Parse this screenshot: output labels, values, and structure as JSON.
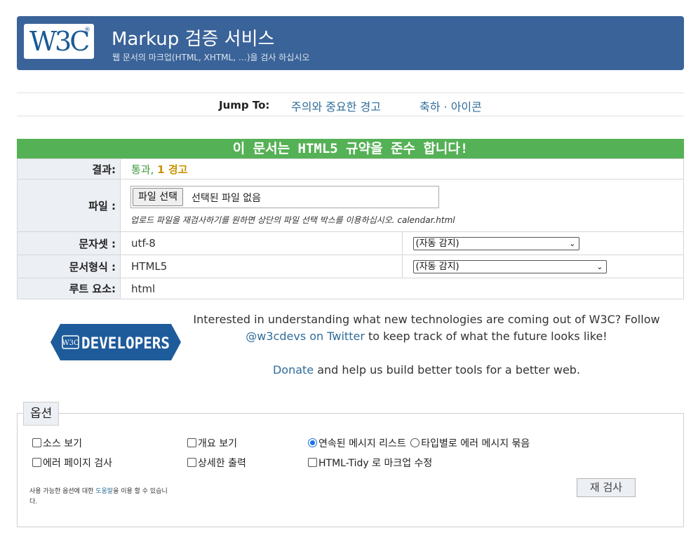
{
  "header": {
    "logo_text": "W3C",
    "logo_reg": "®",
    "title": "Markup 검증 서비스",
    "subtitle": "웹 문서의 마크업(HTML, XHTML, …)을 검사 하십시오"
  },
  "jump": {
    "label": "Jump To:",
    "links": [
      "주의와 중요한 경고",
      "축하 · 아이콘"
    ]
  },
  "result": {
    "banner": "이 문서는 HTML5 규약을 준수 합니다!",
    "rows": {
      "result_label": "결과:",
      "result_pass": "통과,",
      "result_warn": "1 경고",
      "file_label": "파일 :",
      "file_button": "파일 선택",
      "file_status": "선택된 파일 없음",
      "file_note": "업로드 파일을 재검사하기를 원하면 상단의 파일 선택 박스를 이용하십시오. calendar.html",
      "charset_label": "문자셋 :",
      "charset_value": "utf-8",
      "charset_select": "(자동 감지)",
      "doctype_label": "문서형식 :",
      "doctype_value": "HTML5",
      "doctype_select": "(자동 감지)",
      "root_label": "루트 요소:",
      "root_value": "html"
    }
  },
  "promo": {
    "badge_w3c": "W3C",
    "badge_text": "DEVELOPERS",
    "line1": "Interested in understanding what new technologies are coming out of W3C? Follow",
    "twitter_link": "@w3cdevs on Twitter",
    "line2_rest": " to keep track of what the future looks like!",
    "donate_link": "Donate",
    "donate_rest": " and help us build better tools for a better web."
  },
  "options": {
    "legend": "옵션",
    "show_source": "소스 보기",
    "show_outline": "개요 보기",
    "sequential": "연속된 메시지 리스트",
    "group_by_type": "타입별로 에러 메시지 묶음",
    "error_page": "에러 페이지 검사",
    "verbose": "상세한 출력",
    "tidy": "HTML-Tidy 로 마크업 수정",
    "help_prefix": "사용 가능한 옵션에 대한 ",
    "help_link": "도움말",
    "help_suffix": "을 이용 할 수 있습니다.",
    "recheck_button": "재 검사"
  },
  "colors": {
    "banner": "#3a6399",
    "success": "#55b155",
    "link": "#2f6c9a",
    "warning": "#c89400",
    "badge": "#1e5b9b"
  }
}
